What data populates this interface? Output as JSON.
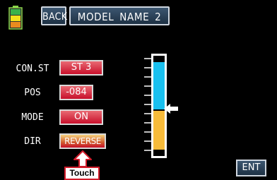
{
  "header": {
    "back_label": "BACK",
    "title": "MODEL NAME  2"
  },
  "rows": [
    {
      "label": "CON.ST",
      "value": "ST 3"
    },
    {
      "label": "POS",
      "value": "-084"
    },
    {
      "label": "MODE",
      "value": "ON"
    },
    {
      "label": "DIR",
      "value": "REVERSE"
    }
  ],
  "gauge": {
    "level_fraction_from_top": 0.55
  },
  "footer": {
    "ent_label": "ENT"
  },
  "annotation": {
    "touch_label": "Touch"
  },
  "colors": {
    "value_button": "#c8102b",
    "gauge_upper": "#19c0ef",
    "gauge_lower": "#f7bb3a",
    "touch_border": "#d11b2a"
  },
  "icons": [
    "battery-icon",
    "pointer-arrow-icon",
    "left-arrow-icon",
    "touch-arrow-icon"
  ]
}
